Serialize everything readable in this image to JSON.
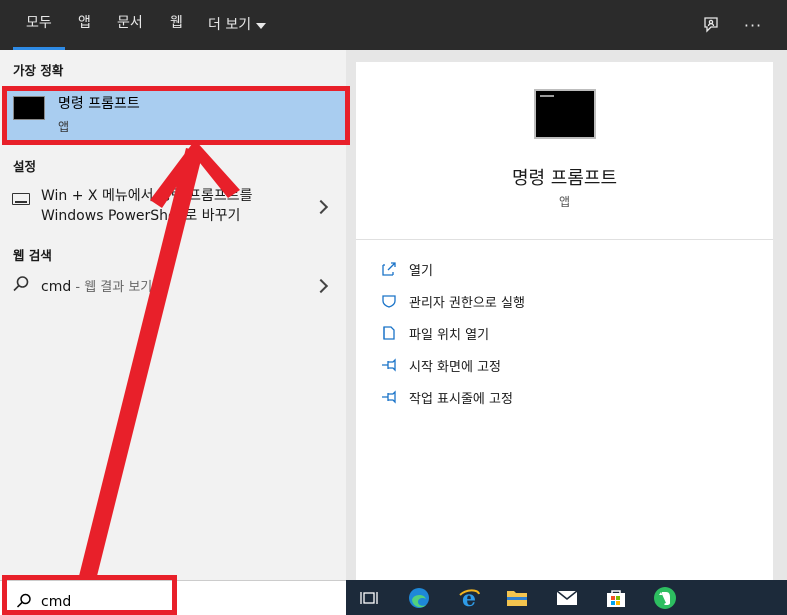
{
  "tabs": [
    {
      "label": "모두",
      "active": true
    },
    {
      "label": "앱"
    },
    {
      "label": "문서"
    },
    {
      "label": "웹"
    },
    {
      "label": "더 보기"
    }
  ],
  "top_icons": [
    "feedback-icon",
    "more-options-icon"
  ],
  "top_more_glyph": "···",
  "left": {
    "best_match_title": "가장 정확",
    "best_match": {
      "name": "명령 프롬프트",
      "type": "앱"
    },
    "settings_title": "설정",
    "setting_item": {
      "line1": "Win + X 메뉴에서 명령 프롬프트를",
      "line2": "Windows PowerShell로 바꾸기"
    },
    "web_title": "웹 검색",
    "web_item": {
      "query": "cmd",
      "suffix": " - 웹 결과 보기"
    }
  },
  "detail": {
    "name": "명령 프롬프트",
    "type": "앱",
    "actions": [
      {
        "label": "열기",
        "icon": "open-icon"
      },
      {
        "label": "관리자 권한으로 실행",
        "icon": "shield-icon"
      },
      {
        "label": "파일 위치 열기",
        "icon": "file-location-icon"
      },
      {
        "label": "시작 화면에 고정",
        "icon": "pin-icon"
      },
      {
        "label": "작업 표시줄에 고정",
        "icon": "pin-icon"
      }
    ]
  },
  "search": {
    "value": "cmd"
  },
  "taskbar": [
    "task-view-icon",
    "edge-icon",
    "internet-explorer-icon",
    "file-explorer-icon",
    "mail-icon",
    "store-icon",
    "evernote-icon"
  ],
  "colors": {
    "accent": "#2e8be6",
    "selection": "#a9cdf0",
    "annotation": "#e8202a",
    "topbar": "#2b2b2b"
  }
}
